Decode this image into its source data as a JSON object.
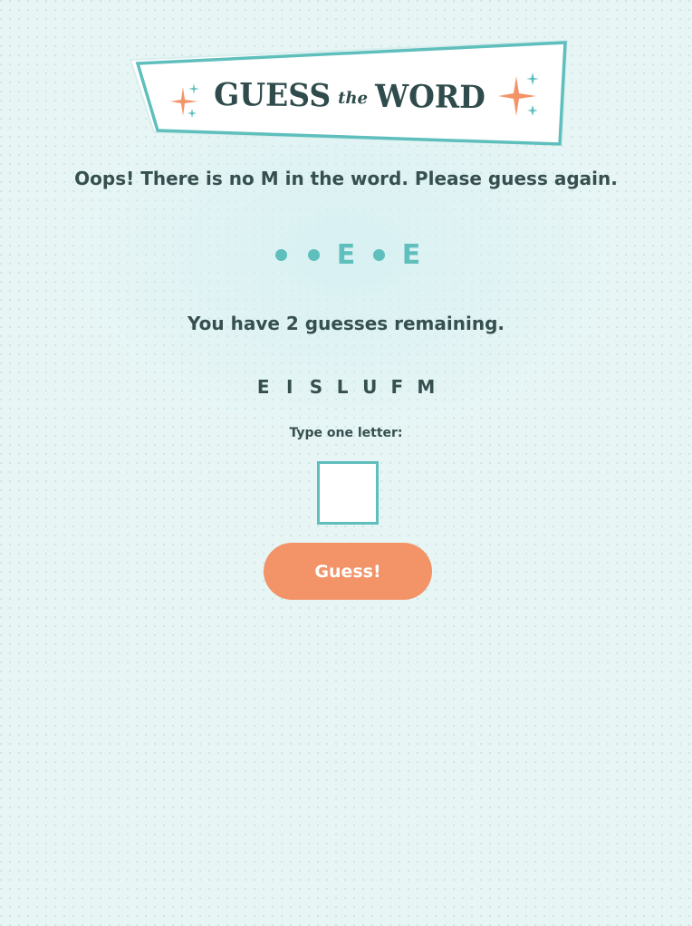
{
  "logo": {
    "word_one": "GUESS",
    "word_the": "the",
    "word_two": "WORD"
  },
  "message": "Oops! There is no M in the word. Please guess again.",
  "word_slots": [
    {
      "revealed": false,
      "letter": ""
    },
    {
      "revealed": false,
      "letter": ""
    },
    {
      "revealed": true,
      "letter": "E"
    },
    {
      "revealed": false,
      "letter": ""
    },
    {
      "revealed": true,
      "letter": "E"
    }
  ],
  "remaining_text": "You have 2 guesses remaining.",
  "guessed_letters": [
    "E",
    "I",
    "S",
    "L",
    "U",
    "F",
    "M"
  ],
  "input": {
    "label": "Type one letter:",
    "value": ""
  },
  "guess_button_label": "Guess!",
  "colors": {
    "accent_teal": "#5ebfbd",
    "accent_coral": "#f29468",
    "text_dark": "#36504f",
    "background": "#e7f5f5"
  },
  "icons": [
    "sparkle-icon"
  ]
}
